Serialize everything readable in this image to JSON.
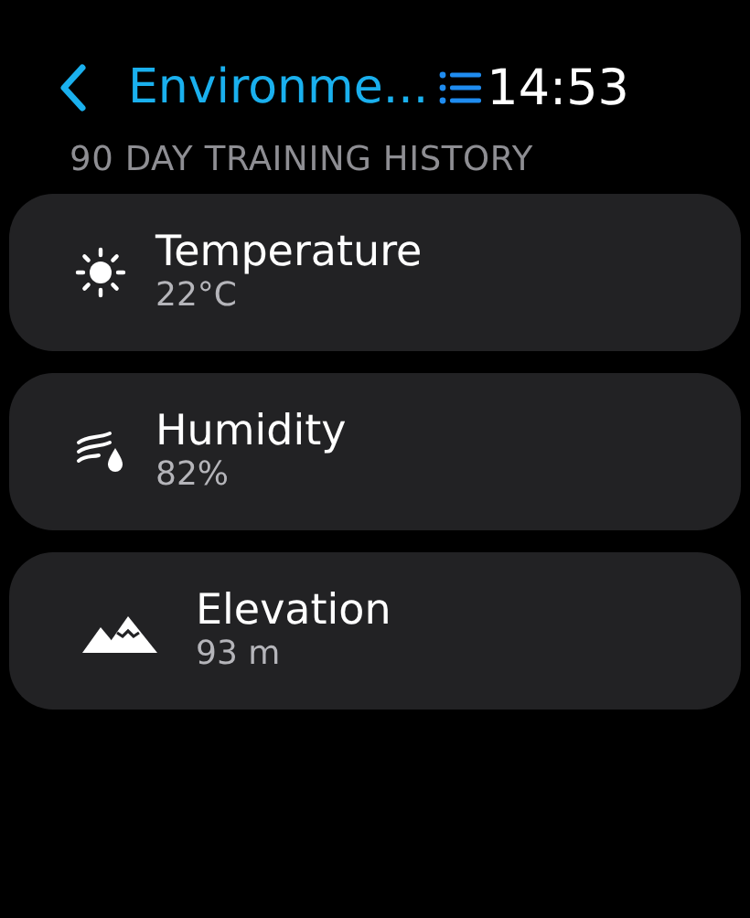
{
  "header": {
    "title": "Environme...",
    "time": "14:53"
  },
  "subtitle": "90 DAY TRAINING HISTORY",
  "items": [
    {
      "kind": "temperature",
      "label": "Temperature",
      "value": "22°C"
    },
    {
      "kind": "humidity",
      "label": "Humidity",
      "value": "82%"
    },
    {
      "kind": "elevation",
      "label": "Elevation",
      "value": "93 m"
    }
  ]
}
